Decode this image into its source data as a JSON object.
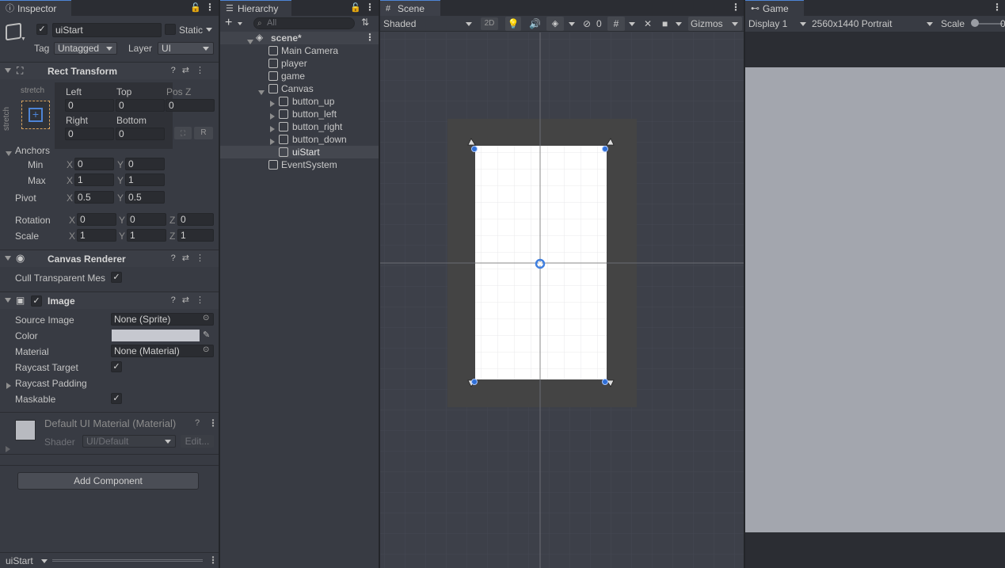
{
  "inspector": {
    "tab": "Inspector",
    "object_name": "uiStart",
    "static_label": "Static",
    "tag_label": "Tag",
    "tag_value": "Untagged",
    "layer_label": "Layer",
    "layer_value": "UI",
    "rect_transform": {
      "title": "Rect Transform",
      "stretch_h": "stretch",
      "stretch_v": "stretch",
      "left_label": "Left",
      "left": "0",
      "top_label": "Top",
      "top": "0",
      "posz_label": "Pos Z",
      "posz": "0",
      "right_label": "Right",
      "right": "0",
      "bottom_label": "Bottom",
      "bottom": "0",
      "r_button": "R",
      "anchors_label": "Anchors",
      "min_label": "Min",
      "min_x": "0",
      "min_y": "0",
      "max_label": "Max",
      "max_x": "1",
      "max_y": "1",
      "pivot_label": "Pivot",
      "pivot_x": "0.5",
      "pivot_y": "0.5",
      "rotation_label": "Rotation",
      "rot_x": "0",
      "rot_y": "0",
      "rot_z": "0",
      "scale_label": "Scale",
      "scale_x": "1",
      "scale_y": "1",
      "scale_z": "1",
      "x": "X",
      "y": "Y",
      "z": "Z"
    },
    "canvas_renderer": {
      "title": "Canvas Renderer",
      "cull_label": "Cull Transparent Mes"
    },
    "image": {
      "title": "Image",
      "source_label": "Source Image",
      "source_value": "None (Sprite)",
      "color_label": "Color",
      "color_value": "#c6c8cf",
      "material_label": "Material",
      "material_value": "None (Material)",
      "raycast_label": "Raycast Target",
      "raycast_padding_label": "Raycast Padding",
      "maskable_label": "Maskable"
    },
    "material_block": {
      "title": "Default UI Material (Material)",
      "shader_label": "Shader",
      "shader_value": "UI/Default",
      "edit_label": "Edit..."
    },
    "add_component": "Add Component",
    "footer_label": "uiStart"
  },
  "hierarchy": {
    "tab": "Hierarchy",
    "search_placeholder": "All",
    "scene": "scene*",
    "items": [
      {
        "label": "Main Camera"
      },
      {
        "label": "player"
      },
      {
        "label": "game"
      },
      {
        "label": "Canvas"
      },
      {
        "label": "button_up"
      },
      {
        "label": "button_left"
      },
      {
        "label": "button_right"
      },
      {
        "label": "button_down"
      },
      {
        "label": "uiStart"
      },
      {
        "label": "EventSystem"
      }
    ]
  },
  "scene": {
    "tab": "Scene",
    "shading": "Shaded",
    "mode_2d": "2D",
    "hidden_count": "0",
    "gizmos": "Gizmos"
  },
  "game": {
    "tab": "Game",
    "display": "Display 1",
    "resolution": "2560x1440 Portrait",
    "scale_label": "Scale",
    "scale_value": "0",
    "viewport_color": "#a3a6ae"
  },
  "colors": {
    "accent": "#4d84d6",
    "panel": "#383b43",
    "selection": "#44474f"
  }
}
